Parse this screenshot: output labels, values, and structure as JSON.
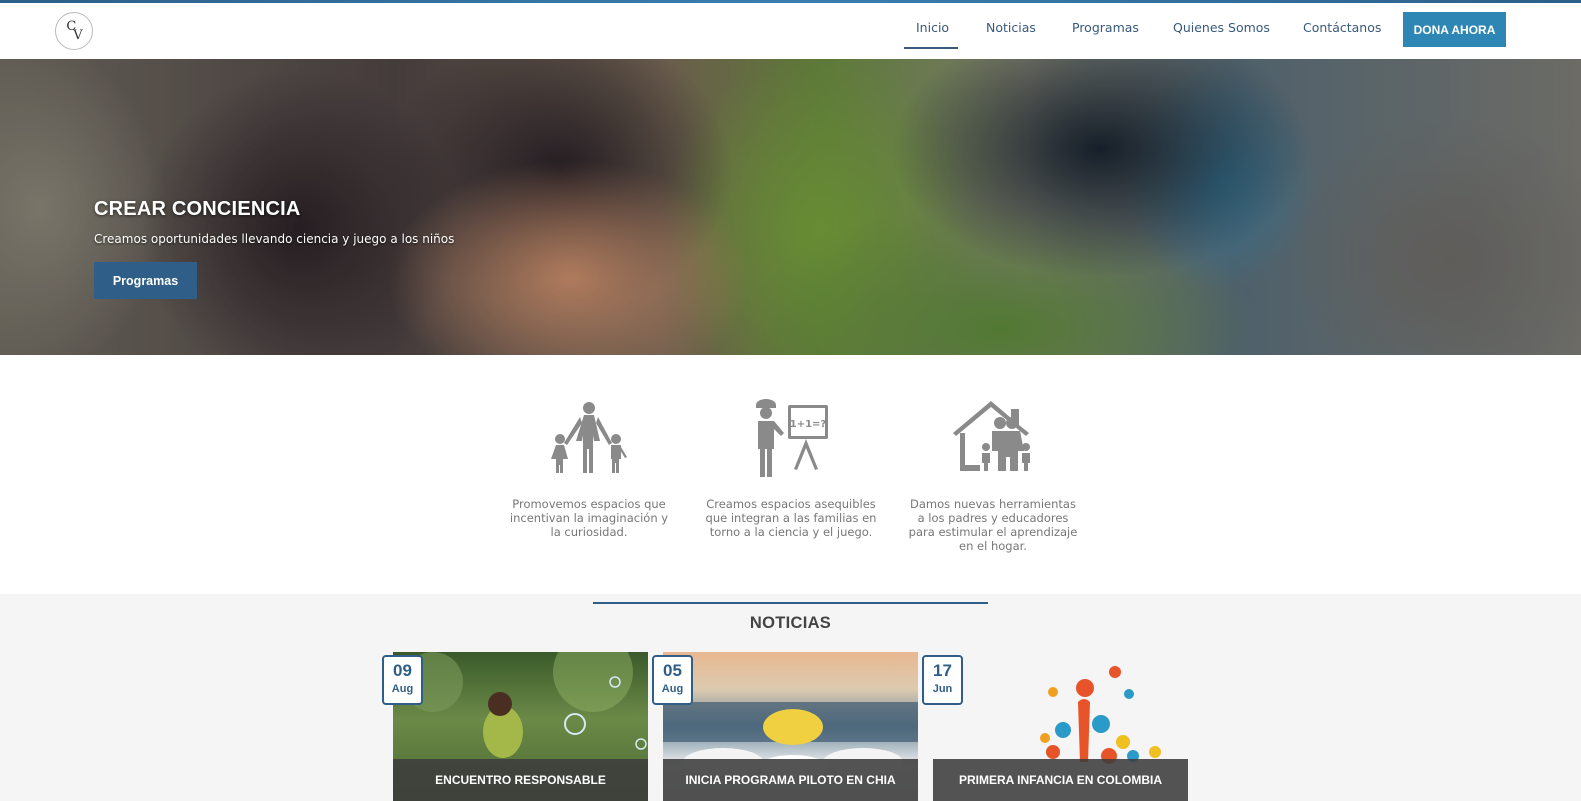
{
  "header": {
    "logo_text_1": "C",
    "logo_text_2": "V",
    "nav": [
      "Inicio",
      "Noticias",
      "Programas",
      "Quienes Somos",
      "Contáctanos"
    ],
    "donate_label": "DONA AHORA"
  },
  "hero": {
    "title": "CREAR CONCIENCIA",
    "subtitle": "Creamos oportunidades llevando ciencia y juego a los niños",
    "button_label": "Programas"
  },
  "features": [
    {
      "icon": "family-icon",
      "text": "Promovemos espacios que incentivan la imaginación y la curiosidad."
    },
    {
      "icon": "teacher-board-icon",
      "text": "Creamos espacios asequibles que integran a las familias en torno a la ciencia y el juego."
    },
    {
      "icon": "home-family-icon",
      "text": "Damos nuevas herramientas a los padres y educadores para estimular el aprendizaje en el hogar."
    }
  ],
  "news": {
    "heading": "NOTICIAS",
    "items": [
      {
        "day": "09",
        "month": "Aug",
        "title": "ENCUENTRO RESPONSABLE"
      },
      {
        "day": "05",
        "month": "Aug",
        "title": "INICIA PROGRAMA PILOTO EN CHIA"
      },
      {
        "day": "17",
        "month": "Jun",
        "title": "PRIMERA INFANCIA EN COLOMBIA"
      }
    ]
  },
  "colors": {
    "accent": "#2f5f88",
    "donate": "#2e86b5",
    "icon_gray": "#8a8a8a"
  },
  "board_text": "1+1=?"
}
